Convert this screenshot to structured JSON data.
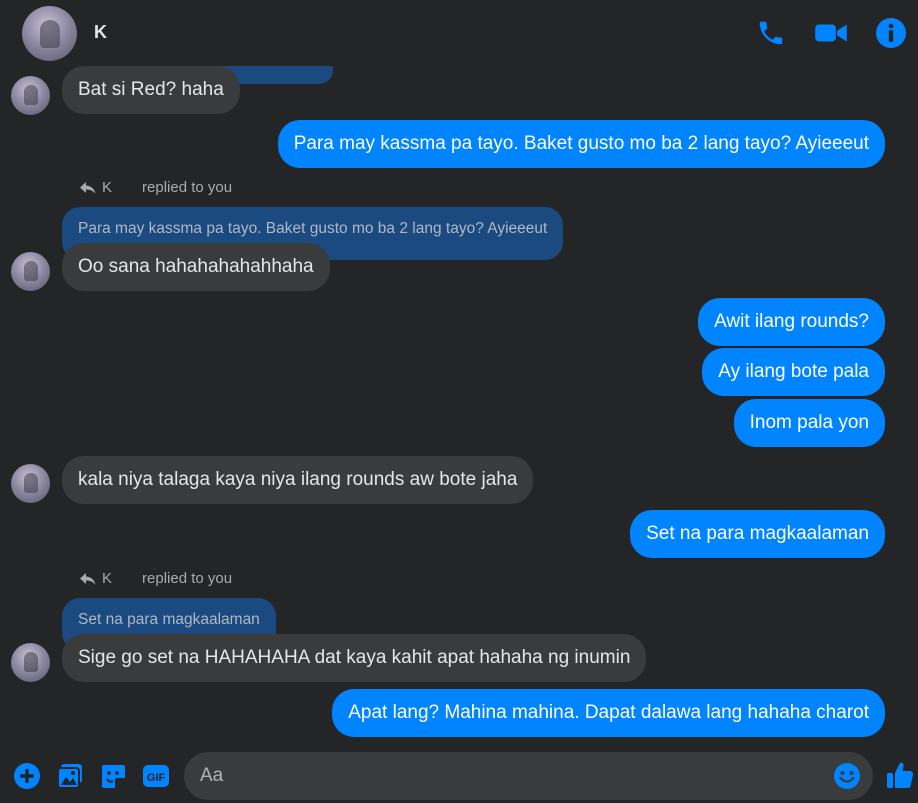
{
  "header": {
    "contact_name": "K",
    "icons": [
      "phone-icon",
      "video-camera-icon",
      "info-icon"
    ]
  },
  "colors": {
    "accent": "#0084ff",
    "incoming": "#3a3b3c",
    "quote": "#1b4a80",
    "background": "#242526"
  },
  "messages": [
    {
      "from": "them",
      "text": "Bat si Red? haha"
    },
    {
      "from": "me",
      "text": "Para may kassma pa tayo.  Baket gusto mo ba 2 lang tayo?  Ayieeeut"
    },
    {
      "from": "them",
      "reply_to": {
        "name": "K",
        "label": "replied to you",
        "quote": "Para may kassma pa tayo. Baket gusto mo ba 2 lang tayo? Ayieeeut"
      },
      "text": "Oo sana hahahahahahhaha"
    },
    {
      "from": "me",
      "text": "Awit ilang rounds?"
    },
    {
      "from": "me",
      "text": "Ay ilang bote pala"
    },
    {
      "from": "me",
      "text": "Inom pala yon"
    },
    {
      "from": "them",
      "text": "kala niya talaga kaya niya ilang rounds aw bote jaha"
    },
    {
      "from": "me",
      "text": "Set na para magkaalaman"
    },
    {
      "from": "them",
      "reply_to": {
        "name": "K",
        "label": "replied to you",
        "quote": "Set na para magkaalaman"
      },
      "text": "Sige go set na HAHAHAHA dat kaya kahit apat hahaha ng inumin"
    },
    {
      "from": "me",
      "text": "Apat lang? Mahina mahina.  Dapat dalawa lang hahaha charot"
    }
  ],
  "composer": {
    "placeholder": "Aa",
    "icons": [
      "add-icon",
      "photo-icon",
      "sticker-icon",
      "gif-icon",
      "emoji-icon",
      "like-icon"
    ],
    "gif_label": "GIF"
  }
}
